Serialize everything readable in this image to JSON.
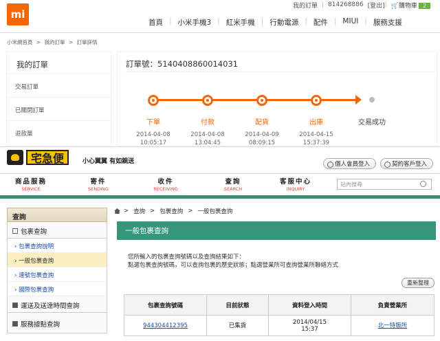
{
  "mi": {
    "logo": "mi",
    "top_links": {
      "my_orders": "我的訂單",
      "user": "814268886",
      "logout": "登出",
      "cart": "購物車",
      "cart_count": "2"
    },
    "nav": [
      "首頁",
      "小米手機3",
      "紅米手機",
      "行動電源",
      "配件",
      "MIUI",
      "服務支援"
    ],
    "breadcrumb": [
      "小米網首頁",
      ">",
      "我的訂單",
      ">",
      "訂單詳情"
    ],
    "sidebar": {
      "title": "我的訂單",
      "items": [
        "交易訂單",
        "已關閉訂單",
        "退款單"
      ]
    },
    "order": {
      "label": "訂單號：",
      "number": "5140408860014031",
      "steps": [
        {
          "name": "下單",
          "date": "2014-04-08",
          "time": "10:05:17"
        },
        {
          "name": "付款",
          "date": "2014-04-08",
          "time": "13:04:45"
        },
        {
          "name": "配貨",
          "date": "2014-04-09",
          "time": "08:09:15"
        },
        {
          "name": "出庫",
          "date": "2014-04-15",
          "time": "15:37:39"
        }
      ],
      "final_step": "交易成功"
    },
    "colors": {
      "accent": "#f56600"
    }
  },
  "tqb": {
    "logo_text": "宅急便",
    "slogan": "小心翼翼 有如親送",
    "buttons": {
      "member_login": "個人會員登入",
      "corporate_login": "契約客戶登入"
    },
    "nav": [
      {
        "zh": "商品服務",
        "en": "SERVICE"
      },
      {
        "zh": "寄件",
        "en": "SENDING"
      },
      {
        "zh": "收件",
        "en": "RECEIVING"
      },
      {
        "zh": "查詢",
        "en": "SEARCH"
      },
      {
        "zh": "客服中心",
        "en": "INQUIRY"
      }
    ],
    "search_placeholder": "站內搜尋",
    "sidebar": {
      "title": "查詢",
      "group1": "包裹查詢",
      "sub": [
        "包裹查詢說明",
        "一般包裹查詢",
        "連號包裹查詢",
        "國際包裹查詢"
      ],
      "group2": "運送及送達時間查詢",
      "group3": "服務據點查詢"
    },
    "breadcrumb": [
      "查詢",
      ">",
      "包裹查詢",
      ">",
      "一般包裹查詢"
    ],
    "title": "一般包裹查詢",
    "desc_line1": "您所輸入的包裹查詢號碼以及查詢結果如下：",
    "desc_line2": "點選包裹查詢號碼，可以查詢包裹的歷史狀態；點選營業所可查詢營業所聯絡方式",
    "refresh": "重新整理",
    "table": {
      "headers": [
        "包裹查詢號碼",
        "目前狀態",
        "資料登入時間",
        "負責營業所"
      ],
      "row": {
        "tracking": "944304412395",
        "status": "已集貨",
        "date": "2014/04/15",
        "time": "15:37",
        "office": "北一特販所"
      }
    },
    "colors": {
      "green": "#35967a",
      "yellow": "#f3c200"
    }
  }
}
